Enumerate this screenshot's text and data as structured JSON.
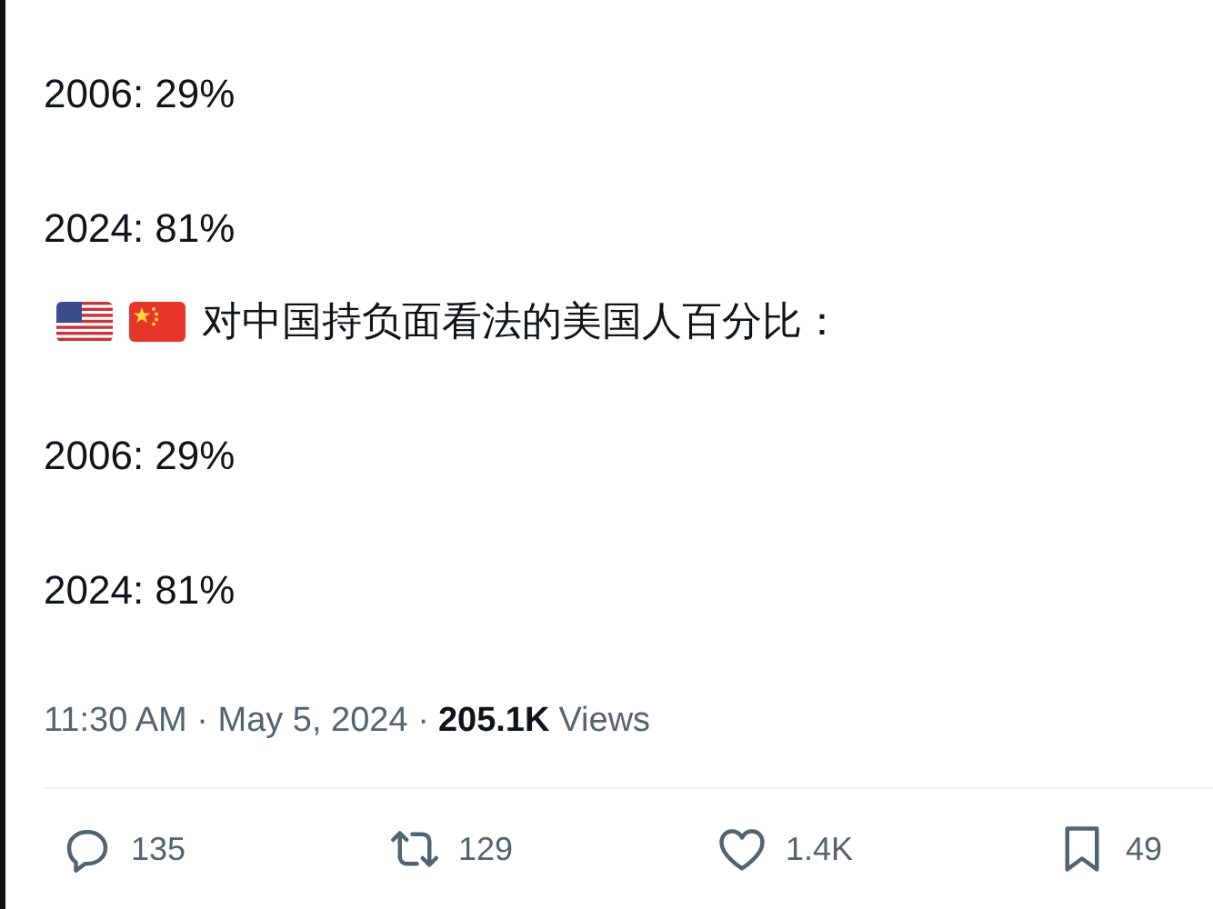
{
  "paragraphs": [
    {
      "kind": "text",
      "text": "2006: 29%"
    },
    {
      "kind": "text",
      "text": "2024: 81%"
    },
    {
      "kind": "flags",
      "text": "对中国持负面看法的美国人百分比："
    },
    {
      "kind": "text",
      "text": "2006: 29%"
    },
    {
      "kind": "text",
      "text": "2024: 81%"
    }
  ],
  "meta": {
    "timestamp": "11:30 AM · May 5, 2024 ·",
    "views_count": "205.1K",
    "views_label": "Views"
  },
  "actions": [
    {
      "kind": "reply",
      "count": "135"
    },
    {
      "kind": "repost",
      "count": "129"
    },
    {
      "kind": "like",
      "count": "1.4K"
    },
    {
      "kind": "bookmark",
      "count": "49"
    }
  ]
}
